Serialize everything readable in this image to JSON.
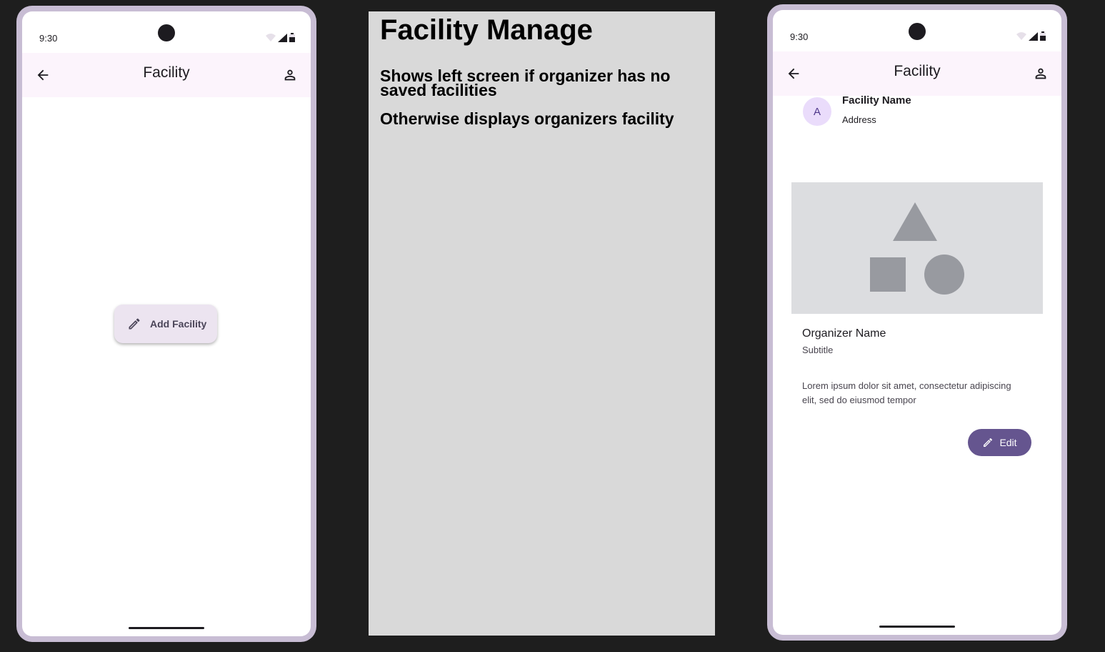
{
  "left_phone": {
    "status_time": "9:30",
    "appbar_title": "Facility",
    "add_button_label": "Add Facility"
  },
  "notes": {
    "heading": "Facility Manage",
    "line1": "Shows left screen if organizer has no saved facilities",
    "line2": "Otherwise displays organizers facility"
  },
  "right_phone": {
    "status_time": "9:30",
    "appbar_title": "Facility",
    "avatar_letter": "A",
    "facility_name": "Facility Name",
    "facility_address": "Address",
    "organizer_name": "Organizer Name",
    "organizer_subtitle": "Subtitle",
    "description": "Lorem ipsum dolor sit amet, consectetur adipiscing elit, sed do eiusmod tempor",
    "edit_button_label": "Edit"
  },
  "colors": {
    "background": "#1e1e1e",
    "phone_frame": "#c8bdd4",
    "appbar": "#fcf4fc",
    "primary": "#65558f",
    "notes_panel": "#d9d9d9"
  }
}
